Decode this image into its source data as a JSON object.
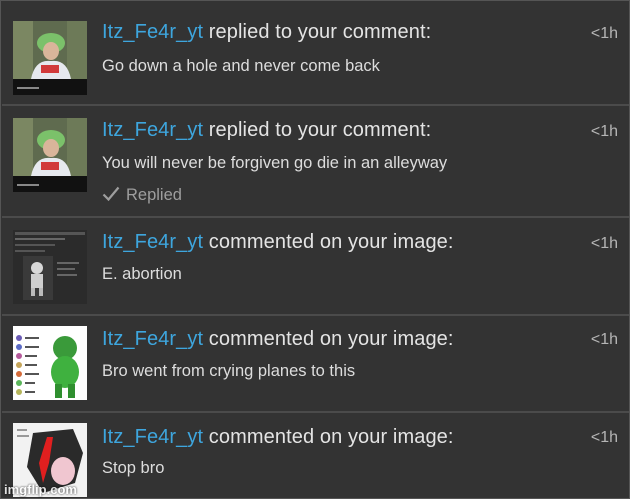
{
  "notifications": [
    {
      "user": "Itz_Fe4r_yt",
      "action": " replied to your comment:",
      "text": "Go down a hole and never come back",
      "time": "<1h",
      "thumb_icon": "video-thumbnail-man-green-hat"
    },
    {
      "user": "Itz_Fe4r_yt",
      "action": " replied to your comment:",
      "text": "You will never be forgiven go die in an alleyway",
      "time": "<1h",
      "status": "Replied",
      "thumb_icon": "video-thumbnail-man-green-hat"
    },
    {
      "user": "Itz_Fe4r_yt",
      "action": " commented on your image:",
      "text": "E. abortion",
      "time": "<1h",
      "thumb_icon": "chat-screenshot-figure"
    },
    {
      "user": "Itz_Fe4r_yt",
      "action": " commented on your image:",
      "text": "Bro went from crying planes to this",
      "time": "<1h",
      "thumb_icon": "green-figure-list"
    },
    {
      "user": "Itz_Fe4r_yt",
      "action": " commented on your image:",
      "text": "Stop bro",
      "time": "<1h",
      "thumb_icon": "pink-black-drawing"
    }
  ],
  "watermark": "imgflip.com",
  "colors": {
    "username": "#3ea6de",
    "background": "#333333",
    "divider": "#4b4b4b"
  }
}
